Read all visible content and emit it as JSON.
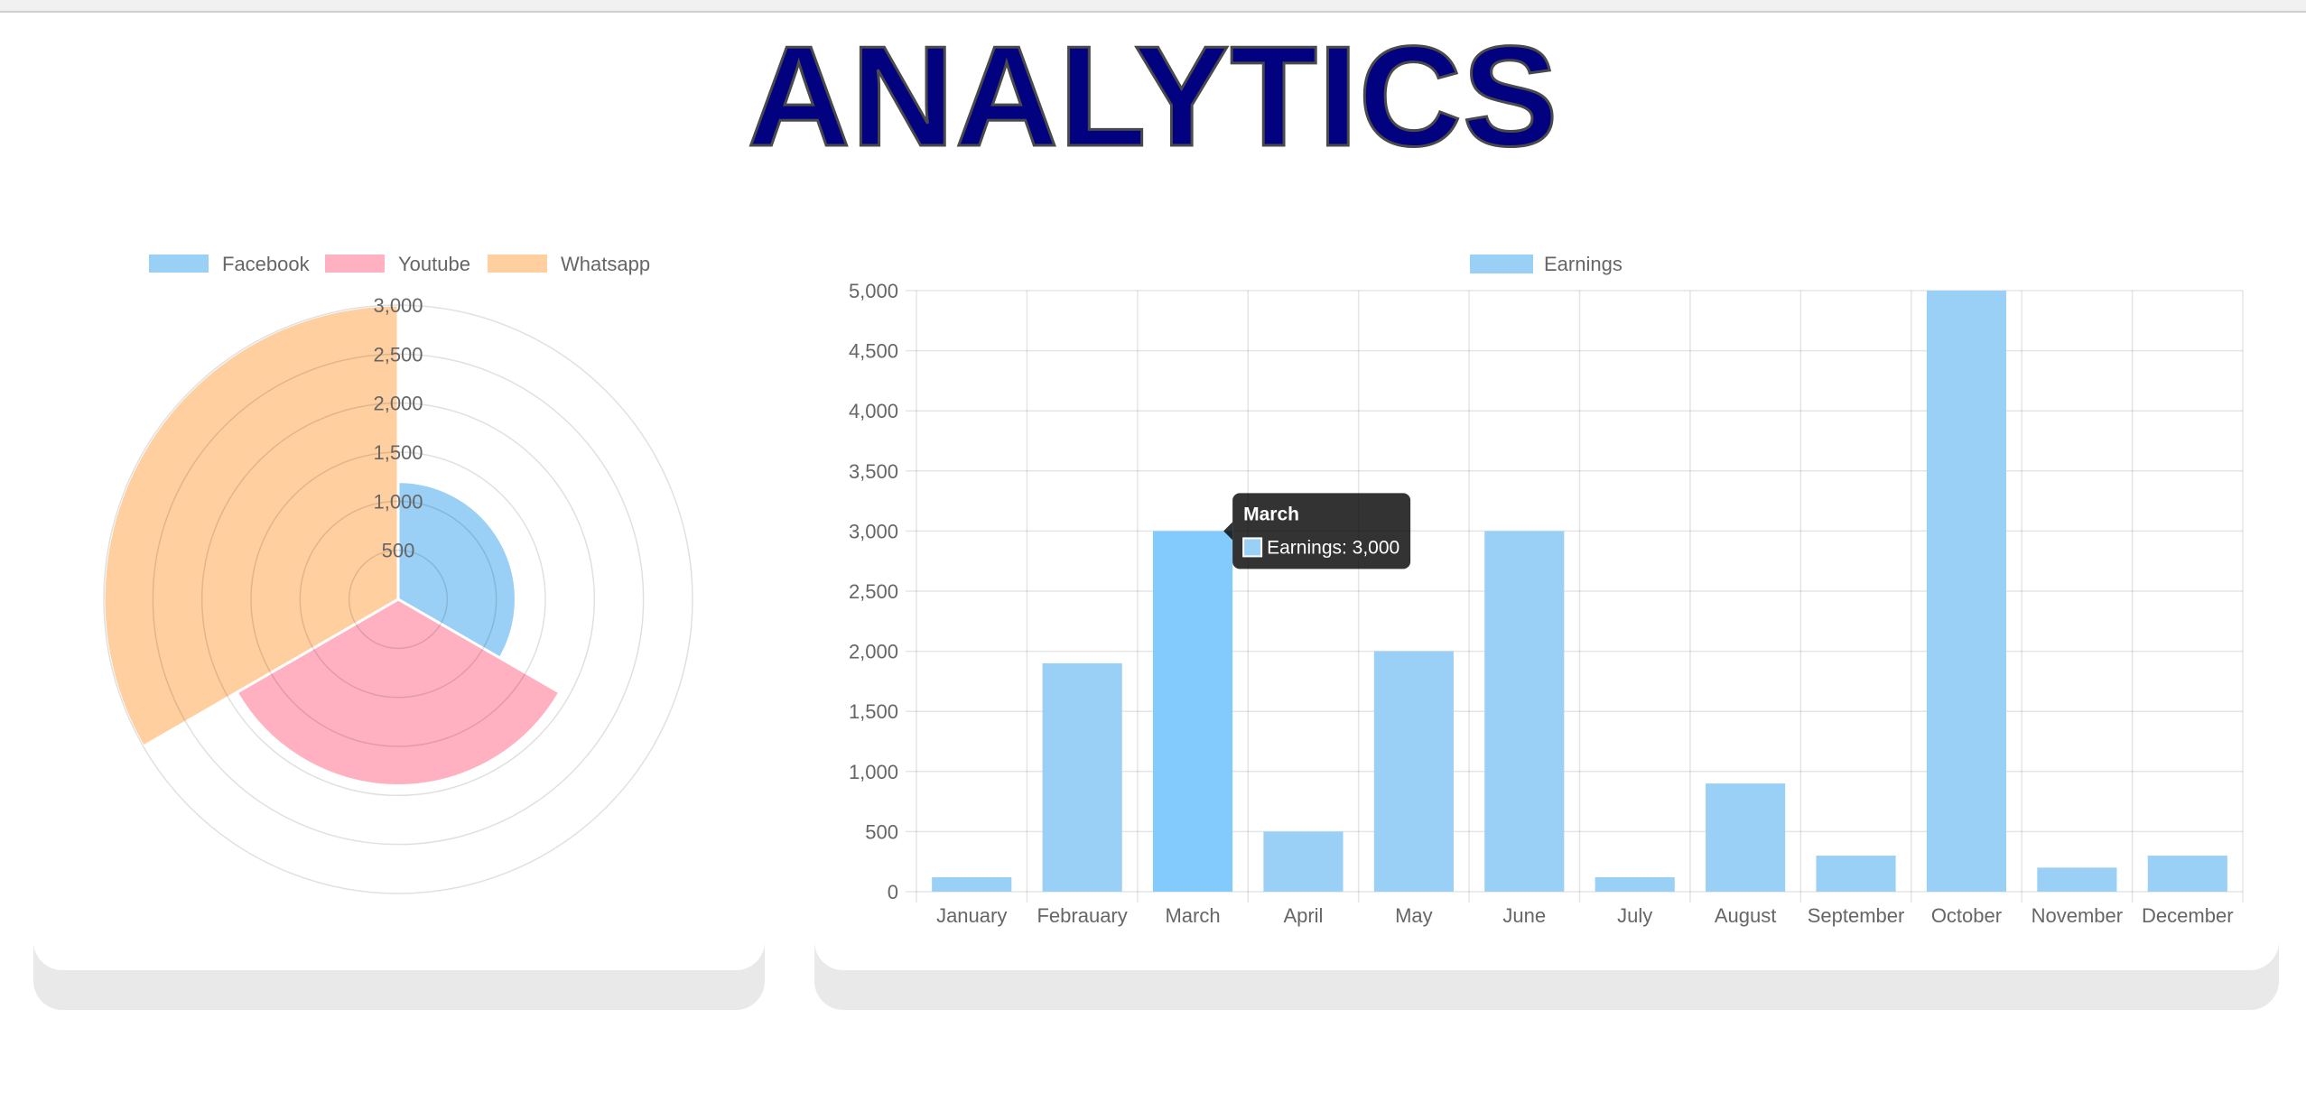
{
  "page": {
    "title": "ANALYTICS"
  },
  "chart_data": [
    {
      "type": "polarArea",
      "categories": [
        "Facebook",
        "Youtube",
        "Whatsapp"
      ],
      "values": [
        1200,
        1900,
        3000
      ],
      "colors": [
        "#9ad0f5",
        "#ffb1c1",
        "#ffcf9f"
      ],
      "r_ticks": [
        500,
        1000,
        1500,
        2000,
        2500,
        3000
      ],
      "r_tick_labels": [
        "500",
        "1,000",
        "1,500",
        "2,000",
        "2,500",
        "3,000"
      ],
      "rlim": [
        0,
        3000
      ],
      "legend": [
        "Facebook",
        "Youtube",
        "Whatsapp"
      ],
      "legend_position": "top",
      "grid": true
    },
    {
      "type": "bar",
      "categories": [
        "January",
        "Febrauary",
        "March",
        "April",
        "May",
        "June",
        "July",
        "August",
        "September",
        "October",
        "November",
        "December"
      ],
      "series": [
        {
          "name": "Earnings",
          "values": [
            120,
            1900,
            3000,
            500,
            2000,
            3000,
            120,
            900,
            300,
            5000,
            200,
            300
          ]
        }
      ],
      "color": "#9ad0f5",
      "highlight_color": "#82cbfc",
      "ylim": [
        0,
        5000
      ],
      "y_ticks": [
        0,
        500,
        1000,
        1500,
        2000,
        2500,
        3000,
        3500,
        4000,
        4500,
        5000
      ],
      "y_tick_labels": [
        "0",
        "500",
        "1,000",
        "1,500",
        "2,000",
        "2,500",
        "3,000",
        "3,500",
        "4,000",
        "4,500",
        "5,000"
      ],
      "legend": [
        "Earnings"
      ],
      "legend_position": "top",
      "grid": true,
      "tooltip": {
        "category": "March",
        "title": "March",
        "label": "Earnings: 3,000"
      }
    }
  ]
}
